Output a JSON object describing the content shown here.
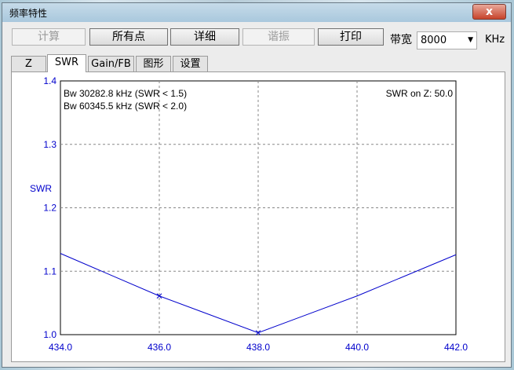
{
  "window": {
    "title": "频率特性",
    "close_label": "x"
  },
  "toolbar": {
    "buttons": [
      {
        "label": "计算",
        "enabled": false
      },
      {
        "label": "所有点",
        "enabled": true
      },
      {
        "label": "详细",
        "enabled": true
      },
      {
        "label": "谐振",
        "enabled": false
      },
      {
        "label": "打印",
        "enabled": true
      }
    ],
    "bandwidth_label": "带宽",
    "bandwidth_value": "8000",
    "unit": "KHz"
  },
  "tabs": [
    {
      "label": "Z",
      "active": false
    },
    {
      "label": "SWR",
      "active": true
    },
    {
      "label": "Gain/FB",
      "active": false
    },
    {
      "label": "图形",
      "active": false
    },
    {
      "label": "设置",
      "active": false
    }
  ],
  "chart_data": {
    "type": "line",
    "title": "",
    "xlabel": "",
    "ylabel": "SWR",
    "xlim": [
      434.0,
      442.0
    ],
    "ylim": [
      1.0,
      1.4
    ],
    "x_ticks": [
      "434.0",
      "436.0",
      "438.0",
      "440.0",
      "442.0"
    ],
    "y_ticks": [
      "1.0",
      "1.1",
      "1.2",
      "1.3",
      "1.4"
    ],
    "grid": true,
    "series": [
      {
        "color": "#0000cc",
        "x": [
          434.0,
          436.0,
          438.0,
          440.0,
          442.0
        ],
        "y": [
          1.128,
          1.061,
          1.003,
          1.061,
          1.126
        ]
      }
    ],
    "markers": [
      {
        "x": 436.0,
        "y": 1.061
      },
      {
        "x": 438.0,
        "y": 1.003
      }
    ],
    "annotations": [
      "Bw 30282.8 kHz (SWR < 1.5)",
      "Bw 60345.5 kHz (SWR < 2.0)",
      "SWR on Z: 50.0"
    ]
  }
}
